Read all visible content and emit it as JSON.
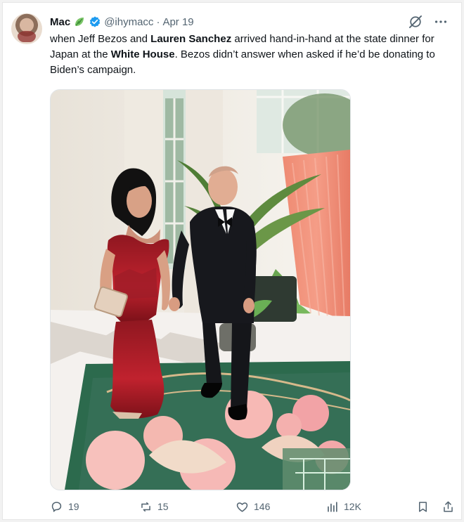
{
  "tweet": {
    "display_name": "Mac",
    "handle": "@ihymacc",
    "separator": "·",
    "date": "Apr 19",
    "text_parts": {
      "p1": "when Jeff Bezos and ",
      "bold1": "Lauren Sanchez",
      "p2": " arrived hand-in-hand at the state dinner for Japan at the ",
      "bold2": "White House",
      "p3": ". Bezos didn’t answer when asked if he’d be donating to Biden’s campaign."
    },
    "stats": {
      "replies": "19",
      "reposts": "15",
      "likes": "146",
      "views": "12K"
    }
  },
  "icons": {
    "leaf": "leaf-icon",
    "verified": "verified-badge-icon",
    "grok": "grok-icon",
    "more": "more-icon",
    "reply": "reply-icon",
    "repost": "repost-icon",
    "like": "like-icon",
    "views": "views-icon",
    "bookmark": "bookmark-icon",
    "share": "share-icon"
  },
  "colors": {
    "text": "#0f1419",
    "secondary": "#536471",
    "verified": "#1d9bf0",
    "leaf": "#6bbf59"
  }
}
